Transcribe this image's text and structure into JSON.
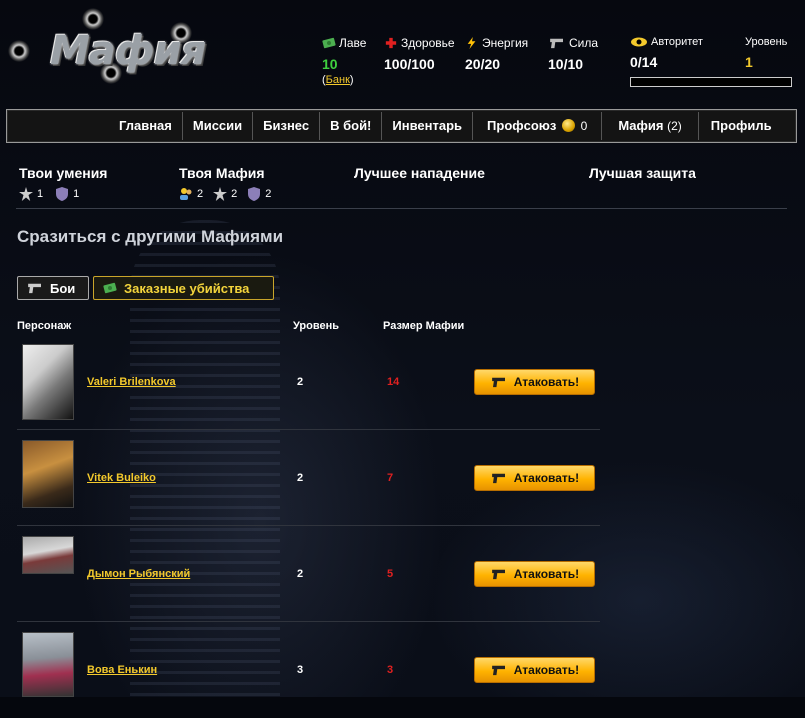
{
  "header": {
    "logo_text": "Мафия",
    "stats": {
      "cash": {
        "label": "Лаве",
        "value": "10",
        "bank_open": "(",
        "bank_link": "Банк",
        "bank_close": ")"
      },
      "health": {
        "label": "Здоровье",
        "value": "100/100"
      },
      "energy": {
        "label": "Энергия",
        "value": "20/20"
      },
      "strength": {
        "label": "Сила",
        "value": "10/10"
      },
      "authority": {
        "label": "Авторитет",
        "value": "0/14",
        "progress_fraction": 0
      },
      "level": {
        "label": "Уровень",
        "value": "1"
      }
    }
  },
  "nav": {
    "items": [
      {
        "label": "Главная"
      },
      {
        "label": "Миссии"
      },
      {
        "label": "Бизнес"
      },
      {
        "label": "В бой!"
      },
      {
        "label": "Инвентарь"
      },
      {
        "label": "Профсоюз",
        "count": "0"
      },
      {
        "label": "Мафия",
        "count": "(2)"
      },
      {
        "label": "Профиль"
      }
    ]
  },
  "skills": {
    "your_skills": {
      "title": "Твои умения",
      "attack": "1",
      "defense": "1"
    },
    "your_mafia": {
      "title": "Твоя Мафия",
      "members": "2",
      "attack": "2",
      "defense": "2"
    },
    "best_attack": {
      "title": "Лучшее нападение"
    },
    "best_defense": {
      "title": "Лучшая защита"
    }
  },
  "section": {
    "title": "Сразиться с другими Мафиями",
    "tabs": {
      "fights": "Бои",
      "hits": "Заказные убийства"
    }
  },
  "table": {
    "headers": {
      "character": "Персонаж",
      "level": "Уровень",
      "mafia_size": "Размер Мафии"
    },
    "rows": [
      {
        "name": "Valeri Brilenkova",
        "level": "2",
        "mafia_size": "14",
        "action": "Атаковать!"
      },
      {
        "name": "Vitek Buleiko",
        "level": "2",
        "mafia_size": "7",
        "action": "Атаковать!"
      },
      {
        "name": "Дымон Рыбянский",
        "level": "2",
        "mafia_size": "5",
        "action": "Атаковать!"
      },
      {
        "name": "Вова Енькин",
        "level": "3",
        "mafia_size": "3",
        "action": "Атаковать!"
      }
    ]
  },
  "colors": {
    "accent_yellow": "#f3c92c",
    "cash_green": "#3fd13f",
    "danger_red": "#e02020",
    "button_orange": "#ffb300"
  }
}
